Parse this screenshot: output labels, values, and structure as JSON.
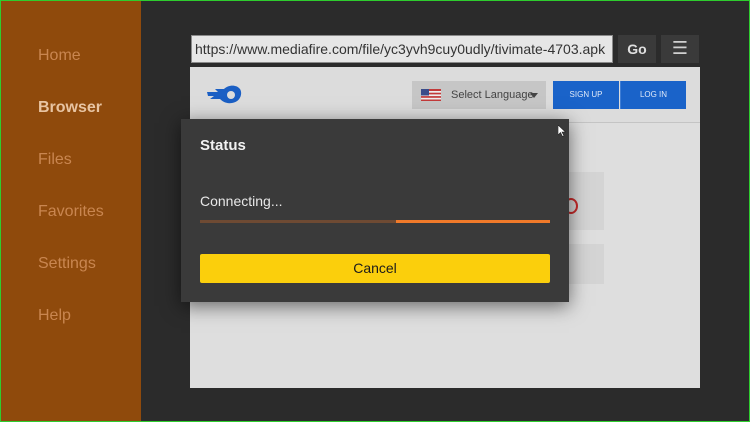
{
  "sidebar": {
    "items": [
      {
        "label": "Home",
        "active": false
      },
      {
        "label": "Browser",
        "active": true
      },
      {
        "label": "Files",
        "active": false
      },
      {
        "label": "Favorites",
        "active": false
      },
      {
        "label": "Settings",
        "active": false
      },
      {
        "label": "Help",
        "active": false
      }
    ]
  },
  "toolbar": {
    "url": "https://www.mediafire.com/file/yc3yvh9cuy0udly/tivimate-4703.apk",
    "go_label": "Go",
    "menu_icon": "hamburger-icon"
  },
  "website": {
    "logo_icon": "mediafire-logo-icon",
    "language_label": "Select Language",
    "flag_icon": "us-flag-icon",
    "signup_label": "SIGN UP",
    "login_label": "LOG IN"
  },
  "dialog": {
    "title": "Status",
    "status_text": "Connecting...",
    "progress_fraction_start": 0.56,
    "progress_fraction_end": 1.0,
    "cancel_label": "Cancel"
  },
  "colors": {
    "sidebar_bg": "#8f4a0c",
    "accent_orange": "#f07a2a",
    "cancel_yellow": "#fbcf0c",
    "link_blue": "#1a63c9"
  }
}
